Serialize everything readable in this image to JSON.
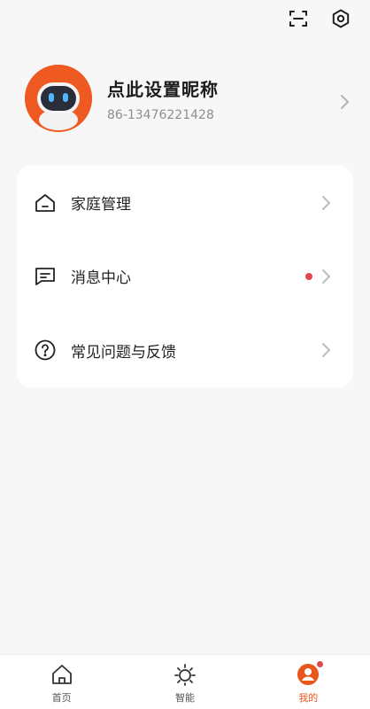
{
  "header": {
    "scan_icon": "scan-icon",
    "settings_icon": "gear-icon"
  },
  "profile": {
    "nickname": "点此设置昵称",
    "phone": "86-13476221428"
  },
  "menu": {
    "items": [
      {
        "label": "家庭管理",
        "icon": "home-outline-icon",
        "has_dot": false
      },
      {
        "label": "消息中心",
        "icon": "message-icon",
        "has_dot": true
      },
      {
        "label": "常见问题与反馈",
        "icon": "help-icon",
        "has_dot": false
      }
    ]
  },
  "bottom_nav": {
    "items": [
      {
        "label": "首页",
        "icon": "home-icon",
        "active": false
      },
      {
        "label": "智能",
        "icon": "sun-icon",
        "active": false
      },
      {
        "label": "我的",
        "icon": "user-icon",
        "active": true,
        "badge": true
      }
    ]
  },
  "colors": {
    "accent": "#e8561c",
    "dot": "#e0474a",
    "background": "#f7f7f7"
  }
}
